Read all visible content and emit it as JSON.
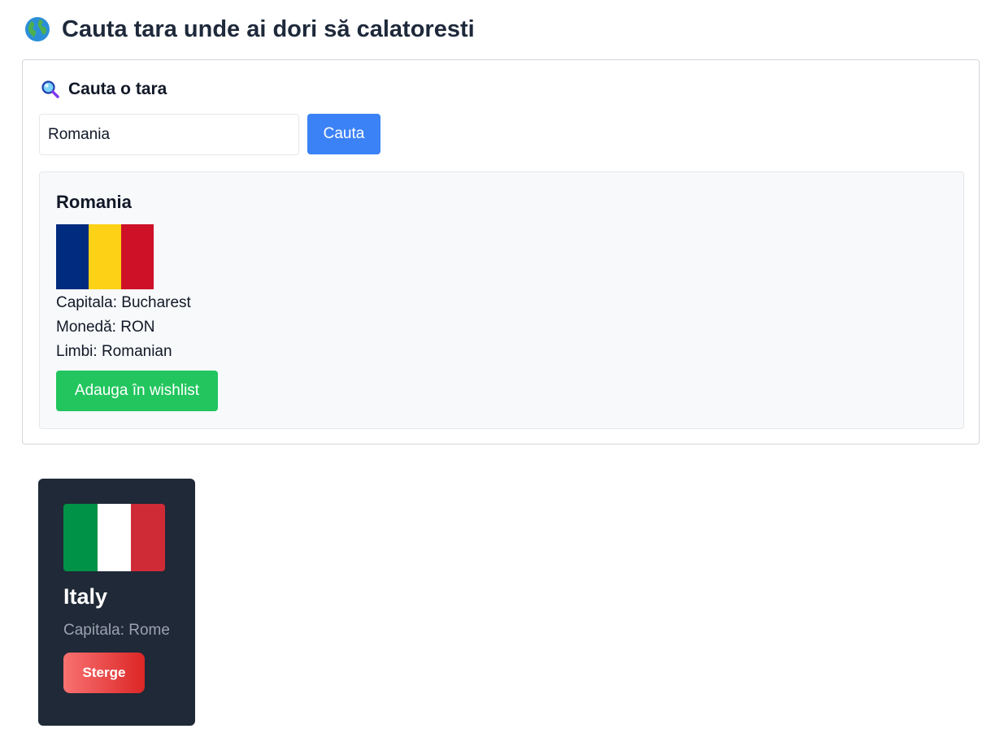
{
  "header": {
    "title": "Cauta tara unde ai dori să calatoresti",
    "icon": "globe-icon"
  },
  "search": {
    "heading": "Cauta o tara",
    "heading_icon": "magnifying-glass-icon",
    "input_value": "Romania",
    "button_label": "Cauta",
    "button_color": "#3b82f6"
  },
  "result": {
    "country_name": "Romania",
    "flag_colors": [
      "#002b7f",
      "#fcd116",
      "#ce1126"
    ],
    "capital_line": "Capitala: Bucharest",
    "currency_line": "Monedă: RON",
    "languages_line": "Limbi: Romanian",
    "wishlist_button_label": "Adauga în wishlist",
    "wishlist_button_color": "#22c55e"
  },
  "wishlist": {
    "items": [
      {
        "country": "Italy",
        "capital_line": "Capitala: Rome",
        "flag_colors": [
          "#009246",
          "#ffffff",
          "#ce2b37"
        ],
        "delete_label": "Sterge"
      }
    ]
  }
}
